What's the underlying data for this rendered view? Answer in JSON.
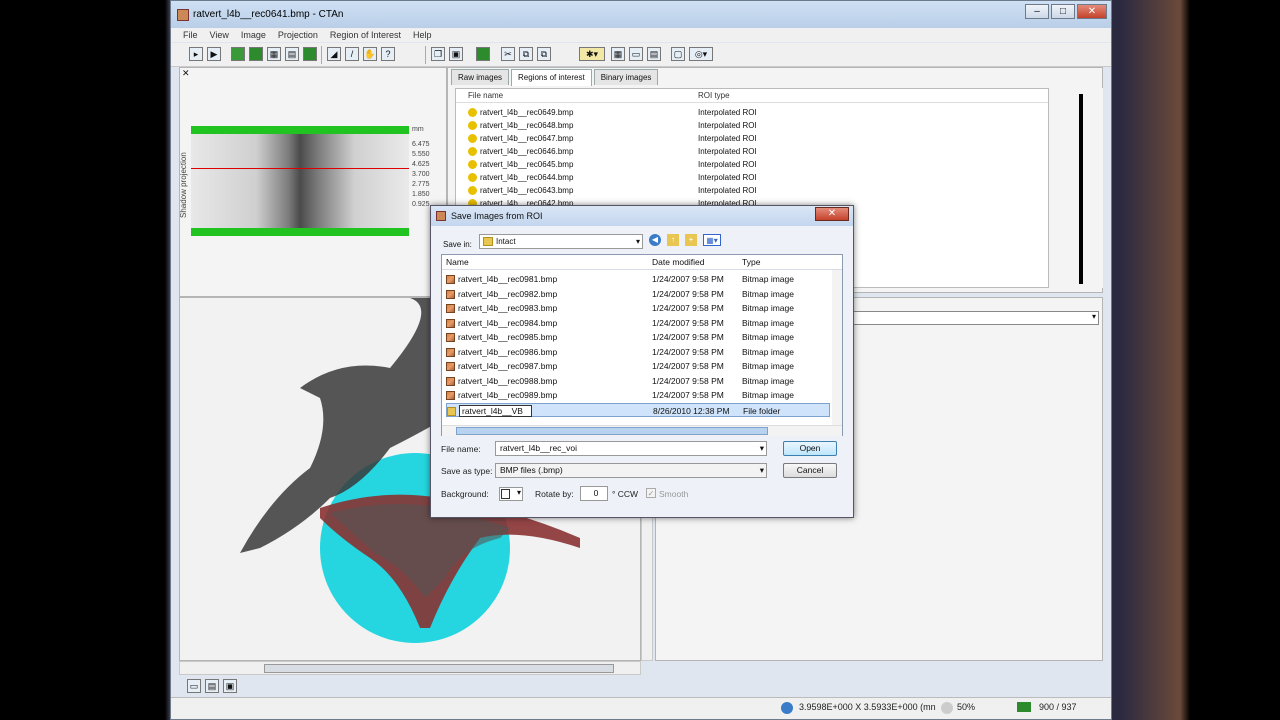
{
  "window": {
    "title": "ratvert_l4b__rec0641.bmp - CTAn",
    "min": "–",
    "max": "□",
    "close": "✕"
  },
  "menu": [
    "File",
    "View",
    "Image",
    "Projection",
    "Region of Interest",
    "Help"
  ],
  "left_panel": {
    "label": "Shadow projection",
    "scale_unit": "mm",
    "scale_ticks": [
      "6.475",
      "5.550",
      "4.625",
      "3.700",
      "2.775",
      "1.850",
      "0.925"
    ]
  },
  "tabs": [
    "Raw images",
    "Regions of interest",
    "Binary images"
  ],
  "file_list": {
    "headers": [
      "File name",
      "ROI type"
    ],
    "rows": [
      {
        "name": "ratvert_l4b__rec0649.bmp",
        "type": "Interpolated ROI"
      },
      {
        "name": "ratvert_l4b__rec0648.bmp",
        "type": "Interpolated ROI"
      },
      {
        "name": "ratvert_l4b__rec0647.bmp",
        "type": "Interpolated ROI"
      },
      {
        "name": "ratvert_l4b__rec0646.bmp",
        "type": "Interpolated ROI"
      },
      {
        "name": "ratvert_l4b__rec0645.bmp",
        "type": "Interpolated ROI"
      },
      {
        "name": "ratvert_l4b__rec0644.bmp",
        "type": "Interpolated ROI"
      },
      {
        "name": "ratvert_l4b__rec0643.bmp",
        "type": "Interpolated ROI"
      },
      {
        "name": "ratvert_l4b__rec0642.bmp",
        "type": "Interpolated ROI"
      }
    ]
  },
  "dialog": {
    "title": "Save Images from ROI",
    "save_in_label": "Save in:",
    "save_in_value": "Intact",
    "columns": [
      "Name",
      "Date modified",
      "Type"
    ],
    "rows": [
      {
        "name": "ratvert_l4b__rec0981.bmp",
        "date": "1/24/2007 9:58 PM",
        "type": "Bitmap image"
      },
      {
        "name": "ratvert_l4b__rec0982.bmp",
        "date": "1/24/2007 9:58 PM",
        "type": "Bitmap image"
      },
      {
        "name": "ratvert_l4b__rec0983.bmp",
        "date": "1/24/2007 9:58 PM",
        "type": "Bitmap image"
      },
      {
        "name": "ratvert_l4b__rec0984.bmp",
        "date": "1/24/2007 9:58 PM",
        "type": "Bitmap image"
      },
      {
        "name": "ratvert_l4b__rec0985.bmp",
        "date": "1/24/2007 9:58 PM",
        "type": "Bitmap image"
      },
      {
        "name": "ratvert_l4b__rec0986.bmp",
        "date": "1/24/2007 9:58 PM",
        "type": "Bitmap image"
      },
      {
        "name": "ratvert_l4b__rec0987.bmp",
        "date": "1/24/2007 9:58 PM",
        "type": "Bitmap image"
      },
      {
        "name": "ratvert_l4b__rec0988.bmp",
        "date": "1/24/2007 9:58 PM",
        "type": "Bitmap image"
      },
      {
        "name": "ratvert_l4b__rec0989.bmp",
        "date": "1/24/2007 9:58 PM",
        "type": "Bitmap image"
      },
      {
        "name": "ratvert_l4b__VB",
        "date": "8/26/2010 12:38 PM",
        "type": "File folder"
      }
    ],
    "file_name_label": "File name:",
    "file_name_value": "ratvert_l4b__rec_voi",
    "save_as_label": "Save as type:",
    "save_as_value": "BMP files (.bmp)",
    "background_label": "Background:",
    "rotate_label": "Rotate by:",
    "rotate_value": "0",
    "rotate_unit": "° CCW",
    "smooth_label": "Smooth",
    "open_button": "Open",
    "cancel_button": "Cancel"
  },
  "status": {
    "coords": "3.9598E+000 X 3.5933E+000 (mn",
    "zoom": "50%",
    "slice": "900 / 937"
  }
}
